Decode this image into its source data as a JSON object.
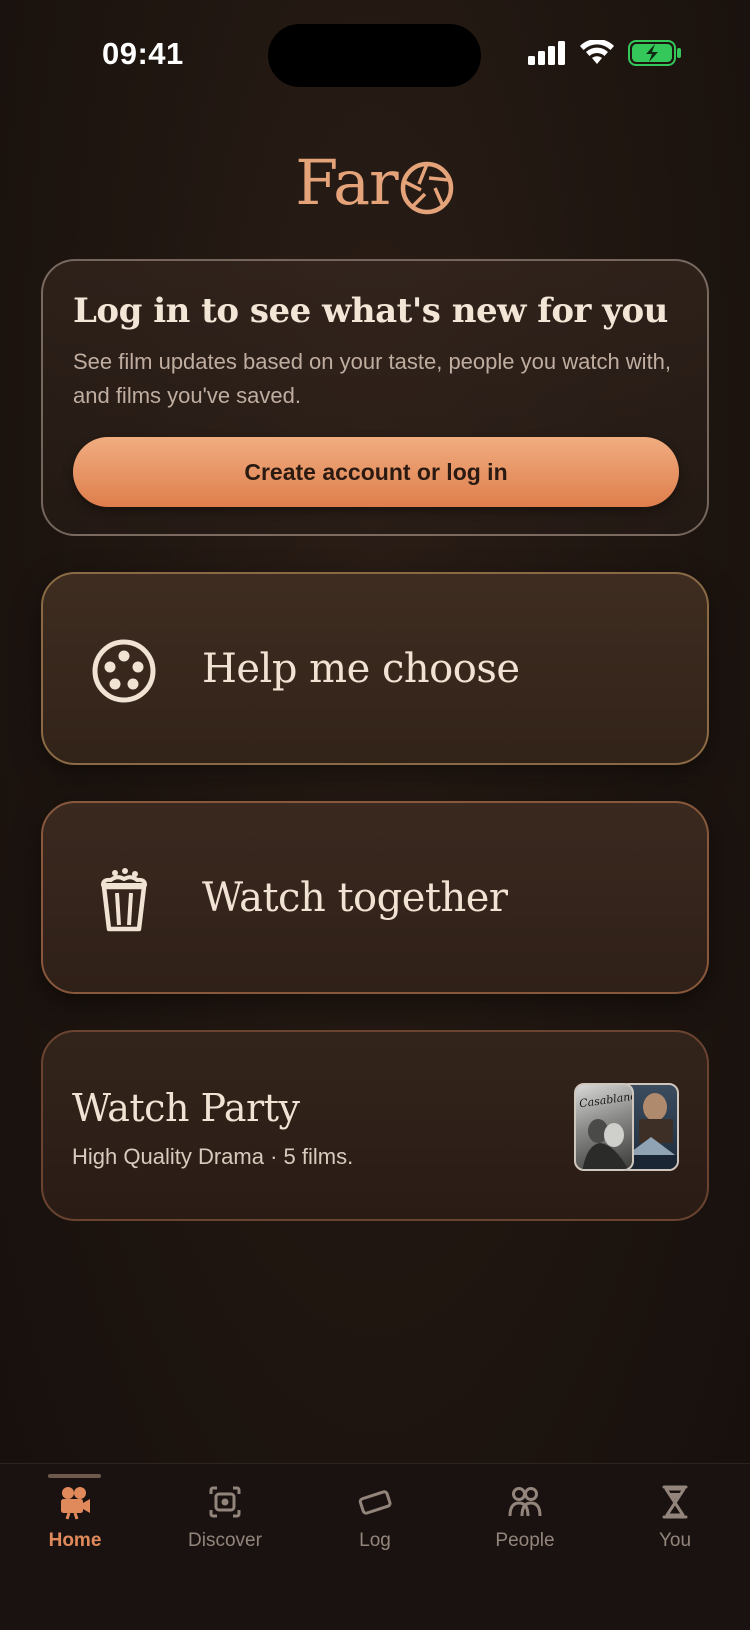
{
  "status_bar": {
    "time": "09:41"
  },
  "logo": {
    "text": "Far"
  },
  "login_card": {
    "title": "Log in to see what's new for you",
    "subtitle": "See film updates based on your taste, people you watch with, and films you've saved.",
    "button_label": "Create account or log in"
  },
  "help_card": {
    "label": "Help me choose",
    "icon": "film-reel-icon"
  },
  "together_card": {
    "label": "Watch together",
    "icon": "popcorn-icon"
  },
  "party_card": {
    "title": "Watch Party",
    "subtitle": "High Quality Drama · 5 films.",
    "poster_1_text": "Casablanca"
  },
  "tabs": [
    {
      "label": "Home",
      "icon": "camera-icon",
      "active": true
    },
    {
      "label": "Discover",
      "icon": "discover-icon",
      "active": false
    },
    {
      "label": "Log",
      "icon": "ticket-icon",
      "active": false
    },
    {
      "label": "People",
      "icon": "people-icon",
      "active": false
    },
    {
      "label": "You",
      "icon": "hourglass-icon",
      "active": false
    }
  ],
  "colors": {
    "accent": "#e08a5b",
    "logo": "#e5a37a",
    "background": "#1e1510",
    "button_top": "#f0ad80",
    "button_bottom": "#df7e4c"
  }
}
